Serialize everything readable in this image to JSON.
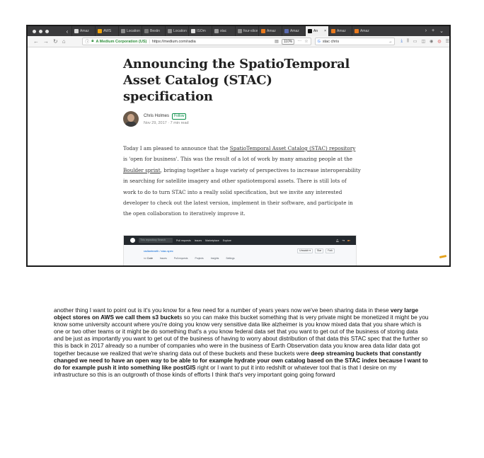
{
  "browser": {
    "tabs": [
      {
        "label": "Amaz",
        "color": "#d9d9d9"
      },
      {
        "label": "AWS",
        "color": "#f0a30a"
      },
      {
        "label": "Location",
        "color": "#8a8a8a"
      },
      {
        "label": "Bestin",
        "color": "#777777"
      },
      {
        "label": "Location",
        "color": "#8a8a8a"
      },
      {
        "label": "ISOm",
        "color": "#e0e0e0"
      },
      {
        "label": "stac",
        "color": "#9a9a9a"
      },
      {
        "label": "four-slice",
        "color": "#888888"
      },
      {
        "label": "Amaz",
        "color": "#e8791e"
      },
      {
        "label": "Amaz",
        "color": "#5a6ab0"
      },
      {
        "label": "An",
        "color": "#111111"
      },
      {
        "label": "Amaz",
        "color": "#e8791e"
      },
      {
        "label": "Amaz",
        "color": "#e8791e"
      }
    ],
    "active_tab_index": 10,
    "identity": "A Medium Corporation (US)",
    "url": "https://medium.com/radia",
    "zoom": "110%",
    "search_value": "stac chris"
  },
  "article": {
    "title": "Announcing the SpatioTemporal Asset Catalog (STAC) specification",
    "author": "Chris Holmes",
    "follow_label": "Follow",
    "date": "Nov 29, 2017 · 7 min read",
    "p1": "Today I am pleased to announce that the ",
    "link1": "SpatioTemporal Asset Catalog (STAC) repository",
    "p2": " is 'open for business'. This was the result of a lot of work by many amazing people at the ",
    "link2": "Boulder sprint",
    "p3": ", bringing together a huge variety of perspectives to increase interoperability in searching for satellite imagery and other spatiotemporal assets. There is still lots of work to do to turn STAC into a really solid specification, but we invite any interested developer to check out the latest version, implement in their software, and participate in the open collaboration to iteratively improve it."
  },
  "github": {
    "search": "This repository  Search",
    "nav": [
      "Pull requests",
      "Issues",
      "Marketplace",
      "Explore"
    ],
    "repo": "radiantearth / stac-spec",
    "buttons": [
      "Unwatch ▾",
      "Star",
      "Fork"
    ],
    "tabs": [
      "<> Code",
      "Issues",
      "Pull requests",
      "Projects",
      "Insights",
      "Settings"
    ]
  },
  "transcript": {
    "t1": "another thing I want to point out is it's you know for a few need for a number of years years now we've been sharing data in these ",
    "b1": "very large object stores on AWS we call them s3 bucket",
    "t2": "s so you can make this bucket something that is very private might be monetized it might be you know some university account where you're doing you know very sensitive data like alzheimer is you know mixed data that you share which is one or two other teams or it might be do something that's a you know federal data set that you want to get out of the business of storing data and be just as importantly you want to get out of the business of having to worry about distribution of that data this STAC spec that the further so this is back in 2017 already so a number of companies who were in the business of Earth Observation data you know area data lidar data got together because we realized that we're sharing data out of these buckets and these buckets were ",
    "b2": "deep streaming buckets that constantly changed we need to have an open way to be able to for example hydrate your own catalog based on the STAC index because I want to do for example push it into something like postGIS",
    "t3": " right or I want to put it into redshift or whatever tool that is that I desire on my infrastructure so this is an outgrowth of those kinds of efforts I think that's very important going going forward"
  }
}
